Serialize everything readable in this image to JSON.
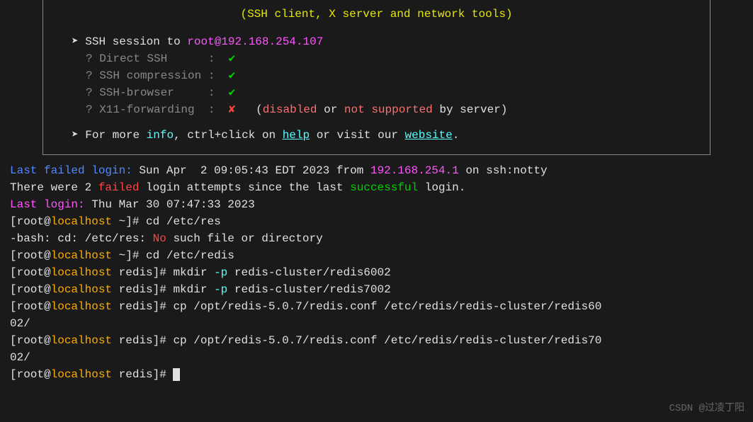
{
  "banner": {
    "subtitle": "(SSH client, X server and network tools)",
    "arrow1": "➤",
    "session_prefix": "SSH session to ",
    "session_target": "root@192.168.254.107",
    "checks": {
      "direct_ssh_label": "? Direct SSH      :  ",
      "compression_label": "? SSH compression :  ",
      "browser_label": "? SSH-browser     :  ",
      "x11_label": "? X11-forwarding  :  ",
      "check_mark": "✔",
      "cross_mark": "✘",
      "x11_open": "   (",
      "x11_disabled": "disabled",
      "x11_or": " or ",
      "x11_not": "not",
      "x11_sp": " ",
      "x11_supported": "supported",
      "x11_by": " by server)"
    },
    "footer_arrow": "➤",
    "footer_prefix": " For more ",
    "footer_info": "info",
    "footer_mid": ", ctrl+click on ",
    "footer_help": "help",
    "footer_or": " or visit our ",
    "footer_website": "website",
    "footer_period": "."
  },
  "login": {
    "failed_label": "Last failed login:",
    "failed_time": " Sun Apr  2 09:05:43 EDT 2023 from ",
    "failed_ip": "192.168.254.1",
    "failed_suffix": " on ssh:notty",
    "attempts_prefix": "There were 2 ",
    "attempts_failed": "failed",
    "attempts_mid": " login attempts since the last ",
    "attempts_success": "successful",
    "attempts_suffix": " login.",
    "last_label": "Last login:",
    "last_time": " Thu Mar 30 07:47:33 2023"
  },
  "prompts": {
    "p1_user": "[root@",
    "p1_host": "localhost",
    "p1_dir_home": " ~]# ",
    "p1_dir_redis": " redis]# ",
    "cmd1": "cd /etc/res",
    "err_prefix": "-bash: cd: /etc/res: ",
    "err_no": "No",
    "err_suffix": " such file or directory",
    "cmd2": "cd /etc/redis",
    "cmd3_a": "mkdir ",
    "cmd3_flag": "-p",
    "cmd3_b": " redis-cluster/redis6002",
    "cmd4_b": " redis-cluster/redis7002",
    "cmd5": "cp /opt/redis-5.0.7/redis.conf /etc/redis/redis-cluster/redis60",
    "cmd5_wrap": "02/",
    "cmd6": "cp /opt/redis-5.0.7/redis.conf /etc/redis/redis-cluster/redis70",
    "cmd6_wrap": "02/"
  },
  "watermark": "CSDN @过凌丁阳"
}
